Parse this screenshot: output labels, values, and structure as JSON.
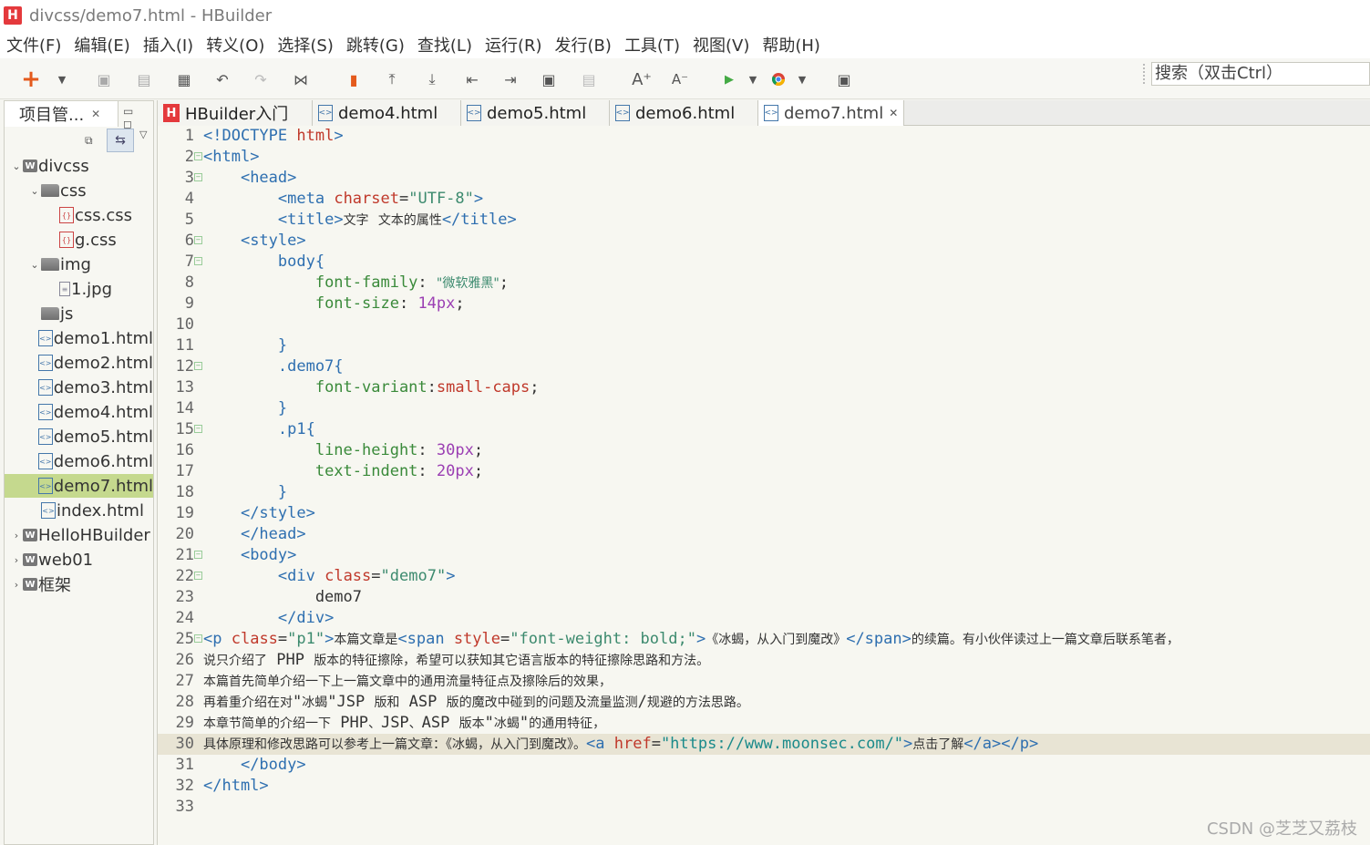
{
  "window": {
    "title": "divcss/demo7.html  -  HBuilder",
    "logo": "H"
  },
  "menu": [
    "文件(F)",
    "编辑(E)",
    "插入(I)",
    "转义(O)",
    "选择(S)",
    "跳转(G)",
    "查找(L)",
    "运行(R)",
    "发行(B)",
    "工具(T)",
    "视图(V)",
    "帮助(H)"
  ],
  "search": {
    "value": "搜索（双击Ctrl）"
  },
  "sidebar": {
    "tab_label": "项目管...",
    "tree": [
      {
        "label": "divcss",
        "type": "project",
        "depth": 0,
        "expanded": true
      },
      {
        "label": "css",
        "type": "folder",
        "depth": 1,
        "expanded": true
      },
      {
        "label": "css.css",
        "type": "css",
        "depth": 2
      },
      {
        "label": "g.css",
        "type": "css",
        "depth": 2
      },
      {
        "label": "img",
        "type": "folder",
        "depth": 1,
        "expanded": true
      },
      {
        "label": "1.jpg",
        "type": "img",
        "depth": 2
      },
      {
        "label": "js",
        "type": "folder",
        "depth": 1
      },
      {
        "label": "demo1.html",
        "type": "html",
        "depth": 1
      },
      {
        "label": "demo2.html",
        "type": "html",
        "depth": 1
      },
      {
        "label": "demo3.html",
        "type": "html",
        "depth": 1
      },
      {
        "label": "demo4.html",
        "type": "html",
        "depth": 1
      },
      {
        "label": "demo5.html",
        "type": "html",
        "depth": 1
      },
      {
        "label": "demo6.html",
        "type": "html",
        "depth": 1
      },
      {
        "label": "demo7.html",
        "type": "html",
        "depth": 1,
        "selected": true
      },
      {
        "label": "index.html",
        "type": "html",
        "depth": 1
      },
      {
        "label": "HelloHBuilder",
        "type": "project",
        "depth": 0,
        "expanded": false
      },
      {
        "label": "web01",
        "type": "project",
        "depth": 0,
        "expanded": false
      },
      {
        "label": "框架",
        "type": "project",
        "depth": 0,
        "expanded": false
      }
    ]
  },
  "tabs": [
    {
      "label": "HBuilder入门",
      "icon": "hbuilder-icon"
    },
    {
      "label": "demo4.html",
      "icon": "html-file-icon"
    },
    {
      "label": "demo5.html",
      "icon": "html-file-icon"
    },
    {
      "label": "demo6.html",
      "icon": "html-file-icon"
    },
    {
      "label": "demo7.html",
      "icon": "html-file-icon",
      "active": true
    }
  ],
  "code_lines": [
    "<!DOCTYPE html>",
    "<html>",
    "    <head>",
    "        <meta charset=\"UTF-8\">",
    "        <title>文字 文本的属性</title>",
    "    <style>",
    "        body{",
    "            font-family: \"微软雅黑\";",
    "            font-size: 14px;",
    "",
    "        }",
    "        .demo7{",
    "            font-variant:small-caps;",
    "        }",
    "        .p1{",
    "            line-height: 30px;",
    "            text-indent: 20px;",
    "        }",
    "    </style>",
    "    </head>",
    "    <body>",
    "        <div class=\"demo7\">",
    "            demo7",
    "        </div>",
    "<p class=\"p1\">本篇文章是<span style=\"font-weight: bold;\">《冰蝎，从入门到魔改》</span>的续篇。有小伙伴读过上一篇文章后联系笔者，",
    "说只介绍了 PHP 版本的特征擦除，希望可以获知其它语言版本的特征擦除思路和方法。",
    "本篇首先简单介绍一下上一篇文章中的通用流量特征点及擦除后的效果，",
    "再着重介绍在对\"冰蝎\"JSP 版和 ASP 版的魔改中碰到的问题及流量监测/规避的方法思路。",
    "本章节简单的介绍一下 PHP、JSP、ASP 版本\"冰蝎\"的通用特征，",
    "具体原理和修改思路可以参考上一篇文章：《冰蝎，从入门到魔改》。<a href=\"https://www.moonsec.com/\">点击了解</a></p>",
    "    </body>",
    "</html>",
    ""
  ],
  "watermark": "CSDN @芝芝又荔枝"
}
